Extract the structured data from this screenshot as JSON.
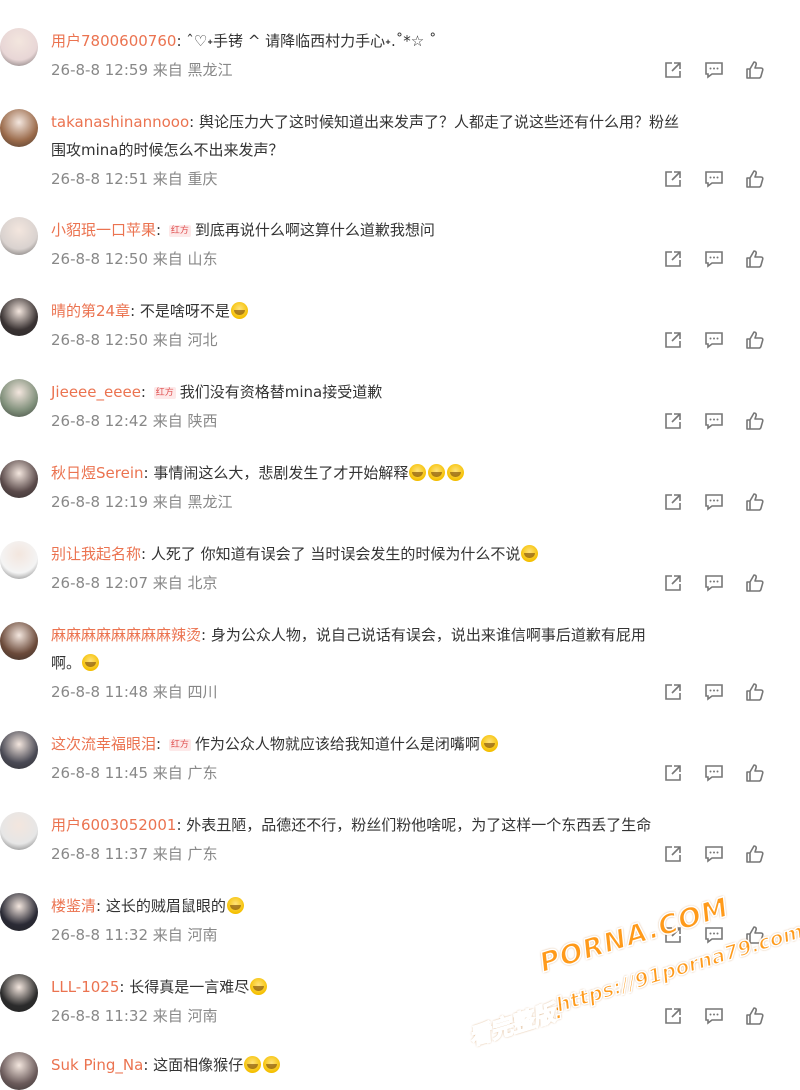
{
  "comments": [
    {
      "user": "用户7800600760",
      "badge": "",
      "text": "ˆ♡˖手铐 ^ 请降临西村力手心˖.˚*☆ ˚",
      "text2": "",
      "emojis": 0,
      "meta": "26-8-8 12:59 来自 黑龙江",
      "avatar": "#e8d6d6"
    },
    {
      "user": "takanashinannooo",
      "badge": "",
      "text": "舆论压力大了这时候知道出来发声了？人都走了说这些还有什么用？粉丝",
      "text2": "围攻mina的时候怎么不出来发声？",
      "emojis": 0,
      "meta": "26-8-8 12:51 来自 重庆",
      "avatar": "#9a6a4a"
    },
    {
      "user": "小貂珉一口苹果",
      "badge": "红方",
      "text": "到底再说什么啊这算什么道歉我想问",
      "text2": "",
      "emojis": 0,
      "meta": "26-8-8 12:50 来自 山东",
      "avatar": "#d9d2cf"
    },
    {
      "user": "晴的第24章",
      "badge": "",
      "text": "不是啥呀不是",
      "text2": "",
      "emojis": 1,
      "meta": "26-8-8 12:50 来自 河北",
      "avatar": "#3a3333"
    },
    {
      "user": "Jieeee_eeee",
      "badge": "红方",
      "text": "我们没有资格替mina接受道歉",
      "text2": "",
      "emojis": 0,
      "meta": "26-8-8 12:42 来自 陕西",
      "avatar": "#7f8f7a"
    },
    {
      "user": "秋日煜Serein",
      "badge": "",
      "text": "事情闹这么大，悲剧发生了才开始解释",
      "text2": "",
      "emojis": 3,
      "meta": "26-8-8 12:19 来自 黑龙江",
      "avatar": "#5a4a4a"
    },
    {
      "user": "别让我起名称",
      "badge": "",
      "text": "人死了 你知道有误会了 当时误会发生的时候为什么不说",
      "text2": "",
      "emojis": 1,
      "meta": "26-8-8 12:07 来自 北京",
      "avatar": "#f4f4f4"
    },
    {
      "user": "麻麻麻麻麻麻麻麻辣烫",
      "badge": "",
      "text": "身为公众人物，说自己说话有误会，说出来谁信啊事后道歉有屁用",
      "text2": "啊。",
      "emojis": 1,
      "meta": "26-8-8 11:48 来自 四川",
      "avatar": "#6b4a3a"
    },
    {
      "user": "这次流幸福眼泪",
      "badge": "红方",
      "text": "作为公众人物就应该给我知道什么是闭嘴啊",
      "text2": "",
      "emojis": 1,
      "meta": "26-8-8 11:45 来自 广东",
      "avatar": "#4a4a55"
    },
    {
      "user": "用户6003052001",
      "badge": "",
      "text": "外表丑陋，品德还不行，粉丝们粉他啥呢，为了这样一个东西丢了生命",
      "text2": "",
      "emojis": 0,
      "meta": "26-8-8 11:37 来自 广东",
      "avatar": "#e6e6e6"
    },
    {
      "user": "楼鉴清",
      "badge": "",
      "text": "这长的贼眉鼠眼的",
      "text2": "",
      "emojis": 1,
      "meta": "26-8-8 11:32 来自 河南",
      "avatar": "#2a2a35"
    },
    {
      "user": "LLL-1025",
      "badge": "",
      "text": "长得真是一言难尽",
      "text2": "",
      "emojis": 1,
      "meta": "26-8-8 11:32 来自 河南",
      "avatar": "#2b2b2b"
    },
    {
      "user": "Suk Ping_Na",
      "badge": "",
      "text": "这面相像猴仔",
      "text2": "",
      "emojis": 2,
      "meta": "",
      "avatar": "#6a5a5a"
    }
  ],
  "watermark": {
    "line1": "PORNA.COM",
    "line2": "https://91porna79.com",
    "line3": "看完整版:"
  }
}
